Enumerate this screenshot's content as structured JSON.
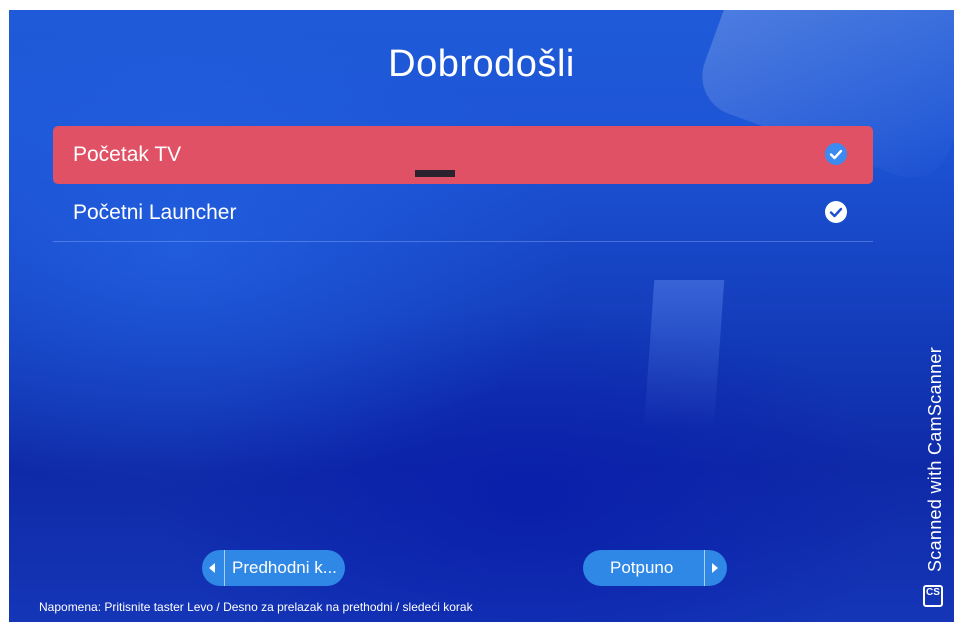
{
  "header": {
    "title": "Dobrodošli"
  },
  "options": [
    {
      "label": "Početak TV",
      "selected": true,
      "checked": true
    },
    {
      "label": "Početni Launcher",
      "selected": false,
      "checked": true
    }
  ],
  "footer": {
    "prev_label": "Predhodni k...",
    "next_label": "Potpuno",
    "note": "Napomena: Pritisnite taster Levo / Desno za prelazak na prethodni / sledeći korak"
  },
  "watermark": {
    "text": "Scanned with CamScanner",
    "logo": "CS"
  },
  "colors": {
    "background": "#1d4fd0",
    "selected_row": "#e05166",
    "button": "#2f87e6",
    "check_selected": "#3d8bf0"
  },
  "icons": {
    "check": "check-circle-icon",
    "prev": "arrow-left-icon",
    "next": "arrow-right-icon"
  }
}
